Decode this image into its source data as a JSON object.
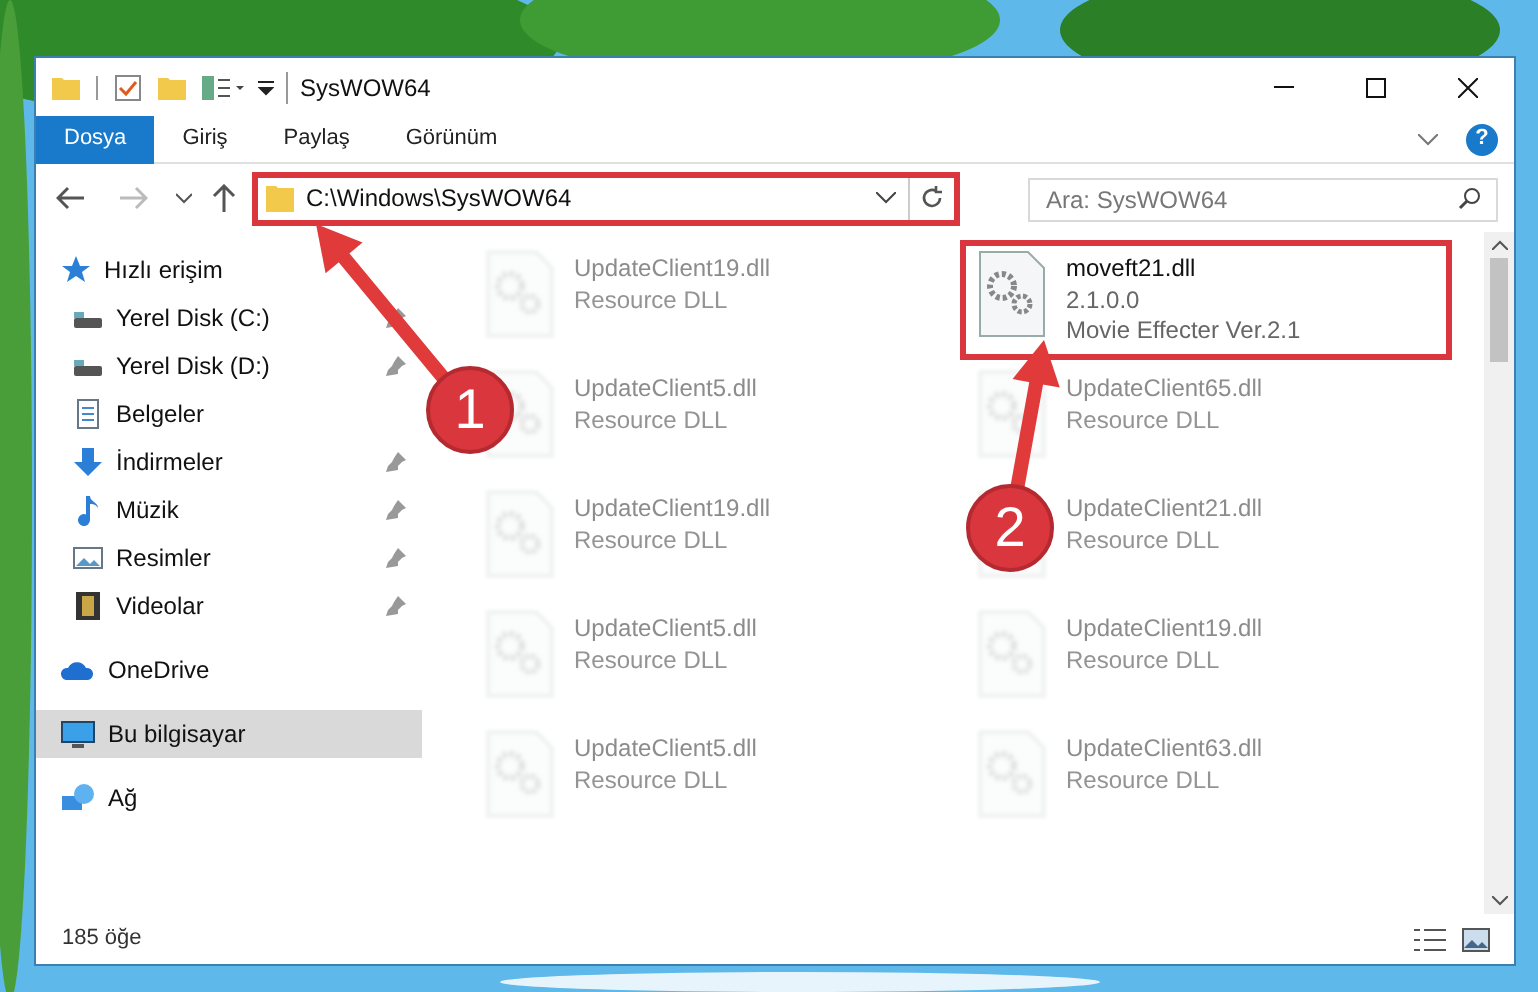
{
  "window": {
    "title": "SysWOW64"
  },
  "ribbon_tabs": [
    {
      "label": "Dosya",
      "selected": true
    },
    {
      "label": "Giriş",
      "selected": false
    },
    {
      "label": "Paylaş",
      "selected": false
    },
    {
      "label": "Görünüm",
      "selected": false
    }
  ],
  "address_bar": {
    "value": "C:\\Windows\\SysWOW64",
    "highlighted": true
  },
  "search": {
    "placeholder": "Ara: SysWOW64"
  },
  "sidebar": {
    "items": [
      {
        "label": "Hızlı erişim",
        "kind": "star",
        "selected": false,
        "children": [
          {
            "label": "Yerel Disk (C:)",
            "kind": "drive",
            "selected": false,
            "pinned": true
          },
          {
            "label": "Yerel Disk (D:)",
            "kind": "drive",
            "selected": false,
            "pinned": true
          },
          {
            "label": "Belgeler",
            "kind": "documents",
            "selected": false,
            "pinned": false
          },
          {
            "label": "İndirmeler",
            "kind": "download",
            "selected": false,
            "pinned": true
          },
          {
            "label": "Müzik",
            "kind": "music",
            "selected": false,
            "pinned": true
          },
          {
            "label": "Resimler",
            "kind": "pictures",
            "selected": false,
            "pinned": true
          },
          {
            "label": "Videolar",
            "kind": "video",
            "selected": false,
            "pinned": true
          }
        ]
      },
      {
        "label": "OneDrive",
        "kind": "cloud",
        "selected": false
      },
      {
        "label": "Bu bilgisayar",
        "kind": "computer",
        "selected": true
      },
      {
        "label": "Ağ",
        "kind": "network",
        "selected": false
      }
    ]
  },
  "files": [
    {
      "name": "UpdateClient19.dll",
      "details": [
        "Resource DLL"
      ],
      "blurred": true,
      "highlighted": false
    },
    {
      "name": "moveft21.dll",
      "details": [
        "2.1.0.0",
        "Movie Effecter Ver.2.1"
      ],
      "blurred": false,
      "highlighted": true
    },
    {
      "name": "UpdateClient5.dll",
      "details": [
        "Resource DLL"
      ],
      "blurred": true,
      "highlighted": false
    },
    {
      "name": "UpdateClient65.dll",
      "details": [
        "Resource DLL"
      ],
      "blurred": true,
      "highlighted": false
    },
    {
      "name": "UpdateClient19.dll",
      "details": [
        "Resource DLL"
      ],
      "blurred": true,
      "highlighted": false
    },
    {
      "name": "UpdateClient21.dll",
      "details": [
        "Resource DLL"
      ],
      "blurred": true,
      "highlighted": false
    },
    {
      "name": "UpdateClient5.dll",
      "details": [
        "Resource DLL"
      ],
      "blurred": true,
      "highlighted": false
    },
    {
      "name": "UpdateClient19.dll",
      "details": [
        "Resource DLL"
      ],
      "blurred": true,
      "highlighted": false
    },
    {
      "name": "UpdateClient5.dll",
      "details": [
        "Resource DLL"
      ],
      "blurred": true,
      "highlighted": false
    },
    {
      "name": "UpdateClient63.dll",
      "details": [
        "Resource DLL"
      ],
      "blurred": true,
      "highlighted": false
    }
  ],
  "status_bar": {
    "item_count": "185 öğe"
  },
  "help_button": {
    "label": "?"
  },
  "annotations": [
    {
      "number": "1"
    },
    {
      "number": "2"
    }
  ]
}
